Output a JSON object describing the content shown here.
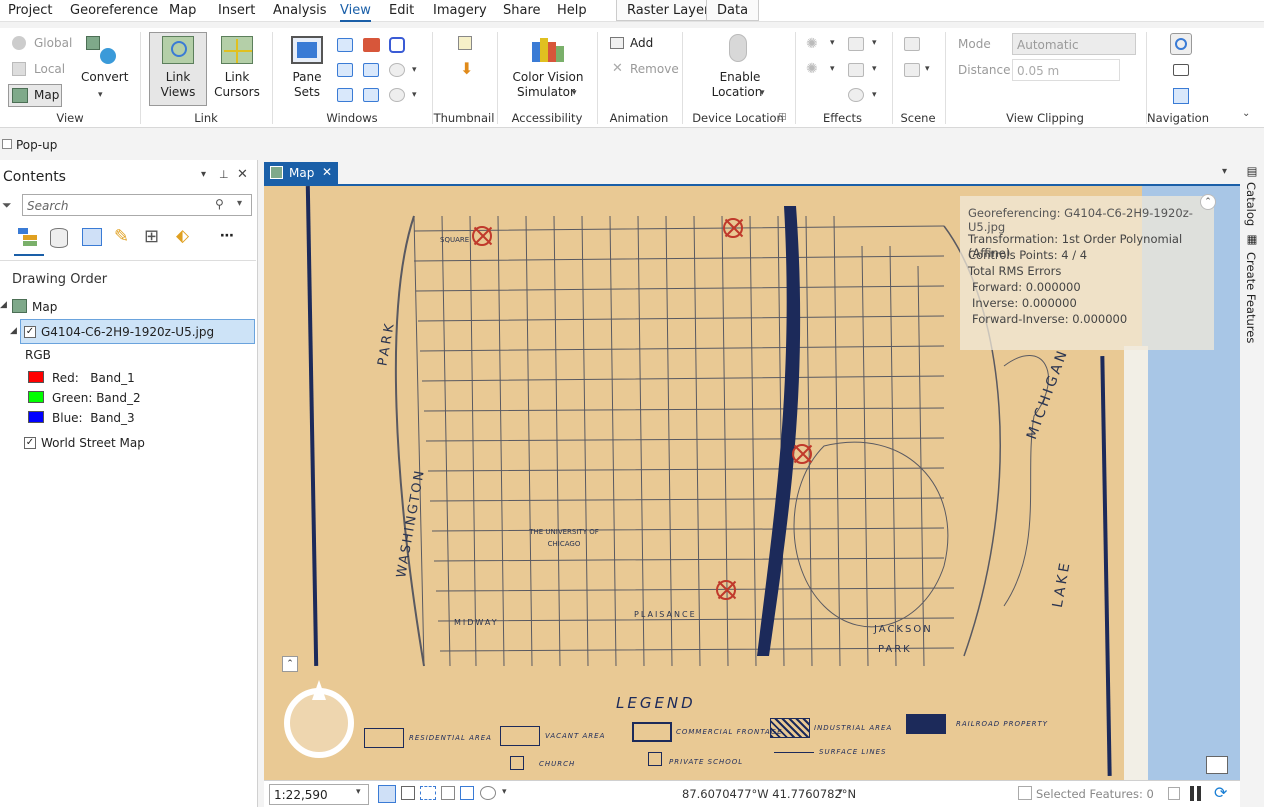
{
  "menu": {
    "items": [
      "Project",
      "Georeference",
      "Map",
      "Insert",
      "Analysis",
      "View",
      "Edit",
      "Imagery",
      "Share",
      "Help"
    ],
    "context_tabs": [
      "Raster Layer",
      "Data"
    ],
    "active": "View"
  },
  "ribbon": {
    "view": {
      "global": "Global",
      "local": "Local",
      "map": "Map",
      "convert": "Convert",
      "label": "View"
    },
    "link": {
      "link_views_1": "Link",
      "link_views_2": "Views",
      "link_cursors_1": "Link",
      "link_cursors_2": "Cursors",
      "label": "Link"
    },
    "windows": {
      "pane_sets_1": "Pane",
      "pane_sets_2": "Sets",
      "label": "Windows"
    },
    "thumbnail": {
      "label": "Thumbnail"
    },
    "accessibility": {
      "cvs_1": "Color Vision",
      "cvs_2": "Simulator",
      "label": "Accessibility"
    },
    "animation": {
      "add": "Add",
      "remove": "Remove",
      "label": "Animation"
    },
    "device_location": {
      "enable_1": "Enable",
      "enable_2": "Location",
      "label": "Device Location"
    },
    "effects": {
      "label": "Effects"
    },
    "scene": {
      "label": "Scene"
    },
    "view_clipping": {
      "mode_label": "Mode",
      "mode_value": "Automatic",
      "distance_label": "Distance",
      "distance_value": "0.05 m",
      "label": "View Clipping"
    },
    "navigation": {
      "label": "Navigation"
    }
  },
  "popup": {
    "label": "Pop-up"
  },
  "contents": {
    "title": "Contents",
    "search_placeholder": "Search",
    "drawing_order": "Drawing Order",
    "map_label": "Map",
    "layer_name": "G4104-C6-2H9-1920z-U5.jpg",
    "rgb": "RGB",
    "bands": [
      {
        "label": "Red:   Band_1",
        "color": "#ff0000"
      },
      {
        "label": "Green: Band_2",
        "color": "#00ff00"
      },
      {
        "label": "Blue:  Band_3",
        "color": "#0000ff"
      }
    ],
    "basemap": "World Street Map"
  },
  "map_tab": {
    "label": "Map"
  },
  "georef": {
    "title": "Georeferencing: G4104-C6-2H9-1920z-U5.jpg",
    "transformation": "Transformation: 1st Order Polynomial (Affine)",
    "control_points": "Controls Points: 4 / 4",
    "rms": "Total RMS Errors",
    "forward": "Forward: 0.000000",
    "inverse": "Inverse: 0.000000",
    "forward_inverse": "Forward-Inverse: 0.000000"
  },
  "map_labels": {
    "washington": "WASHINGTON",
    "park": "PARK",
    "jackson": "JACKSON",
    "jackson_park": "PARK",
    "lake": "LAKE",
    "michigan": "MICHIGAN",
    "legend": "LEGEND",
    "university": "THE UNIVERSITY OF CHICAGO",
    "midway": "MIDWAY",
    "plaisance": "PLAISANCE",
    "square": "SQUARE",
    "legend_items": [
      "RESIDENTIAL AREA",
      "VACANT AREA",
      "COMMERCIAL FRONTAGE",
      "INDUSTRIAL AREA",
      "RAILROAD PROPERTY",
      "CHURCH",
      "PRIVATE SCHOOL",
      "SURFACE LINES"
    ]
  },
  "status": {
    "scale": "1:22,590",
    "coords": "87.6070477°W 41.7760782°N",
    "selected": "Selected Features: 0"
  },
  "right_rail": {
    "catalog": "Catalog",
    "create_features": "Create Features"
  }
}
